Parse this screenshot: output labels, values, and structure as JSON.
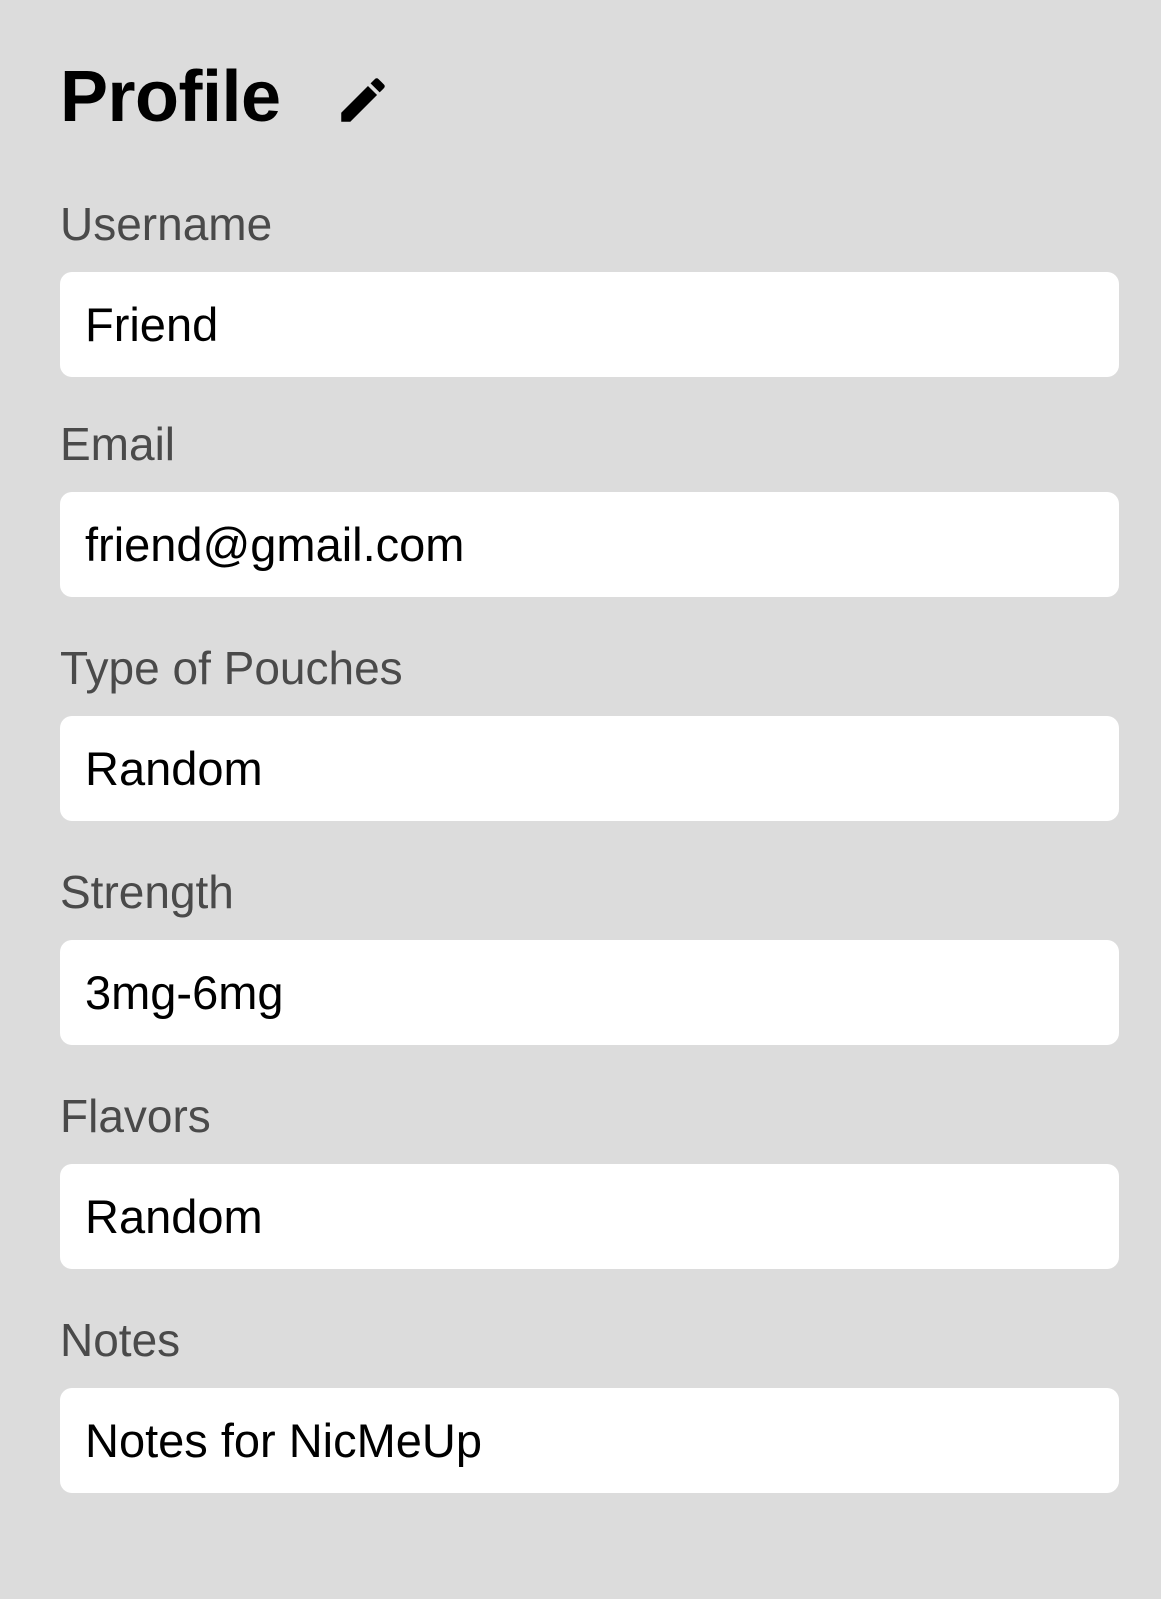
{
  "header": {
    "title": "Profile",
    "edit_icon": "pencil-icon"
  },
  "fields": [
    {
      "label": "Username",
      "value": "Friend"
    },
    {
      "label": "Email",
      "value": "friend@gmail.com"
    },
    {
      "label": "Type of Pouches",
      "value": "Random"
    },
    {
      "label": "Strength",
      "value": "3mg-6mg"
    },
    {
      "label": "Flavors",
      "value": "Random"
    },
    {
      "label": "Notes",
      "value": "Notes for NicMeUp"
    }
  ],
  "colors": {
    "background": "#dcdcdc",
    "input_background": "#ffffff",
    "label": "#4a4a4a",
    "text": "#000000"
  }
}
